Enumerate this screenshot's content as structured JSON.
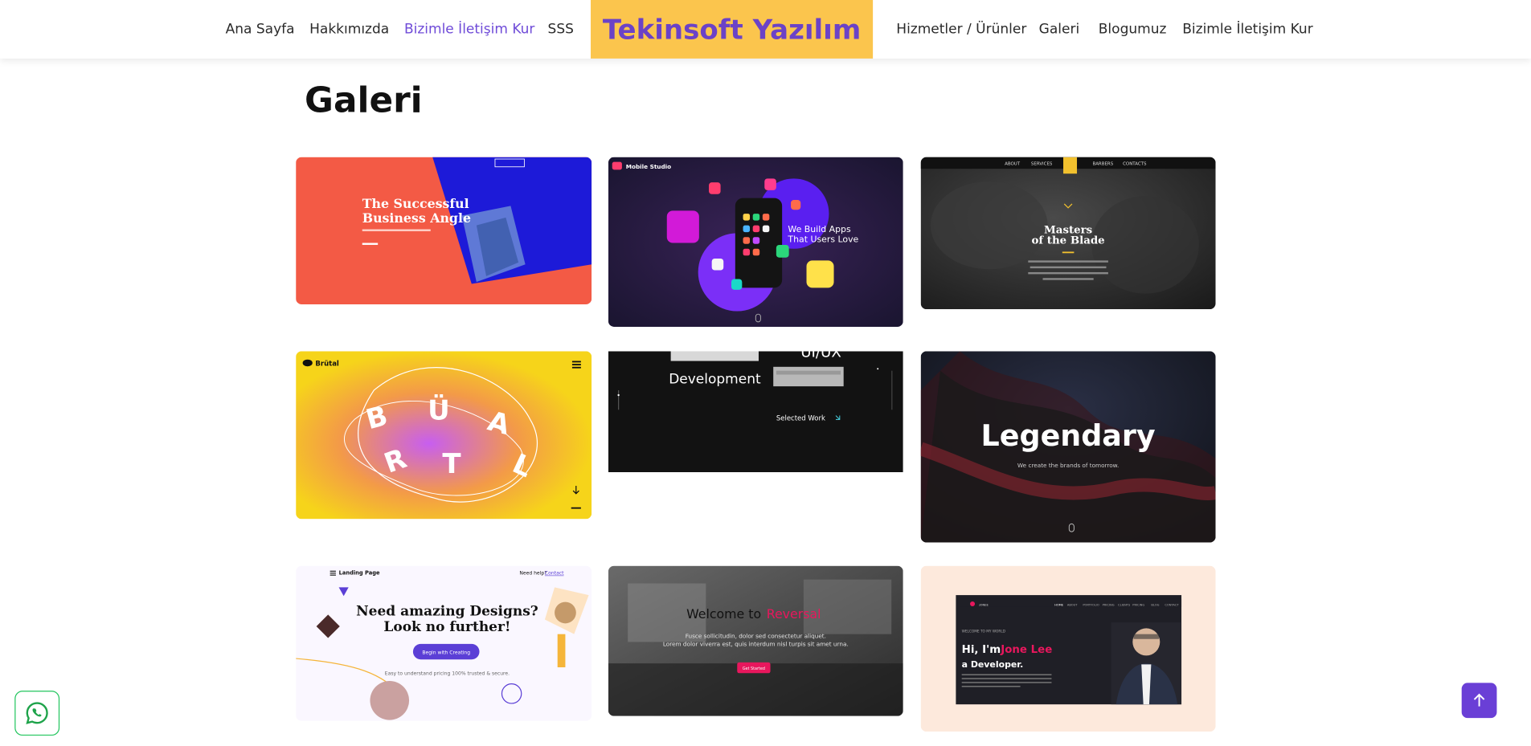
{
  "nav": {
    "left": [
      "Ana Sayfa",
      "Hakkımızda",
      "Bizimle İletişim Kur",
      "SSS"
    ],
    "brand": "Tekinsoft Yazılım",
    "right": [
      "Hizmetler / Ürünler",
      "Galeri",
      "Blogumuz",
      "Bizimle İletişim Kur"
    ],
    "active_label": "Bizimle İletişim Kur"
  },
  "page": {
    "title": "Galeri"
  },
  "gallery": [
    {
      "headline": "The Successful Business Angle",
      "bg": "#f35a45",
      "accent": "#1d1ad8"
    },
    {
      "brand": "Mobile Studio",
      "headline": "We Build Apps That Users Love",
      "bg": "#201a3c",
      "accent": "#7b2ff7"
    },
    {
      "headline": "Masters of the Blade",
      "text": "Establish your new amazing look with barbershop services! From haircuts to hot shaves, you can experience the best level of barbering in the area.",
      "nav": [
        "ABOUT",
        "SERVICES",
        "BARBERS",
        "CONTACTS"
      ],
      "bg": "#2a2a2a",
      "accent": "#f2c12e"
    },
    {
      "brand": "Brütal",
      "word": "BRÜTAL",
      "bg": "#f6d41a",
      "accent": "#c65cf0"
    },
    {
      "headline": "Development",
      "sub": "UI/UX",
      "link": "Selected Work",
      "bg": "#121212"
    },
    {
      "headline": "Legendary",
      "text": "We create the brands of tomorrow.",
      "bg": "#141820",
      "accent": "#8c2431"
    },
    {
      "brand": "Landing Page",
      "headline": "Need amazing Designs? Look no further!",
      "button": "Begin with Creating",
      "text": "Easy to understand pricing 100% trusted & secure.",
      "help": "Need help?",
      "contact": "Contact",
      "bg": "#faf7ff",
      "accent": "#5b3fd6"
    },
    {
      "headline": "Welcome to ",
      "highlight": "Reversal",
      "text": "Fusce sollicitudin, dolor sed consectetur aliquet. Lorem dolor viverra est, quis interdum nisl turpis sit amet urna.",
      "button": "Get Started",
      "bg": "#4a4a4a",
      "accent": "#e8175d"
    },
    {
      "greeting": "Hi, I'm ",
      "name": "Jone Lee",
      "role": "a Developer.",
      "bg": "#fde9dc",
      "accent": "#e8175d"
    }
  ],
  "icons": {
    "whatsapp": "whatsapp-icon",
    "scroll_top": "arrow-up-icon"
  },
  "colors": {
    "brand_bg": "#fbc54d",
    "brand_text": "#6b42c7",
    "active_link": "#6f4bd8",
    "scroll_top_bg": "#6a3fd6",
    "whatsapp": "#22c55e"
  }
}
